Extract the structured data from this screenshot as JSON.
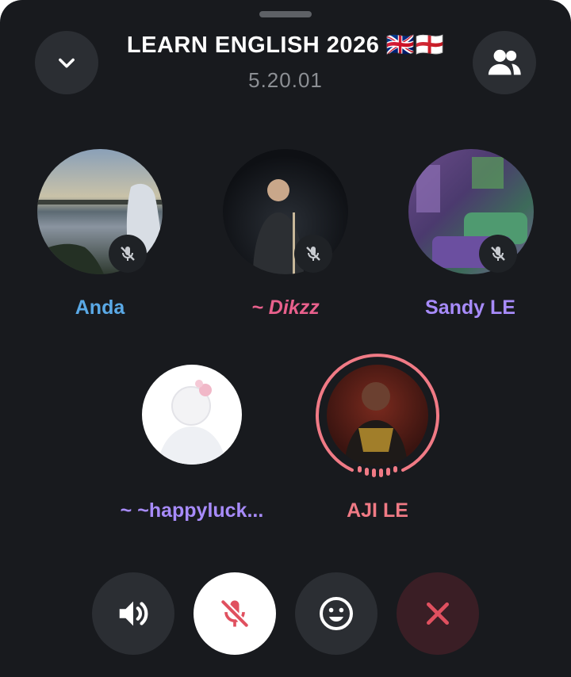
{
  "header": {
    "title": "LEARN ENGLISH 2026 🇬🇧🏴󠁧󠁢󠁥󠁮󠁧󠁿",
    "subtitle": "5.20.01",
    "collapse_icon": "chevron-down-icon",
    "participants_icon": "people-icon"
  },
  "participants": [
    {
      "name": "Anda",
      "color": "#5aa9e6",
      "muted": true
    },
    {
      "name": "~ Dikzz",
      "color": "#e8608c",
      "muted": true
    },
    {
      "name": "Sandy LE",
      "color": "#a78bfa",
      "muted": true
    },
    {
      "name": "~ ~happyluck...",
      "color": "#a78bfa",
      "muted": false
    },
    {
      "name": "AJI LE",
      "color": "#f07a85",
      "speaking": true
    }
  ],
  "controls": [
    {
      "icon": "speaker-icon"
    },
    {
      "icon": "mic-off-icon"
    },
    {
      "icon": "emoji-icon"
    },
    {
      "icon": "close-icon"
    }
  ],
  "colors": {
    "background": "#181a1e",
    "speaking_ring": "#f07a85",
    "leave": "#e0505f"
  }
}
